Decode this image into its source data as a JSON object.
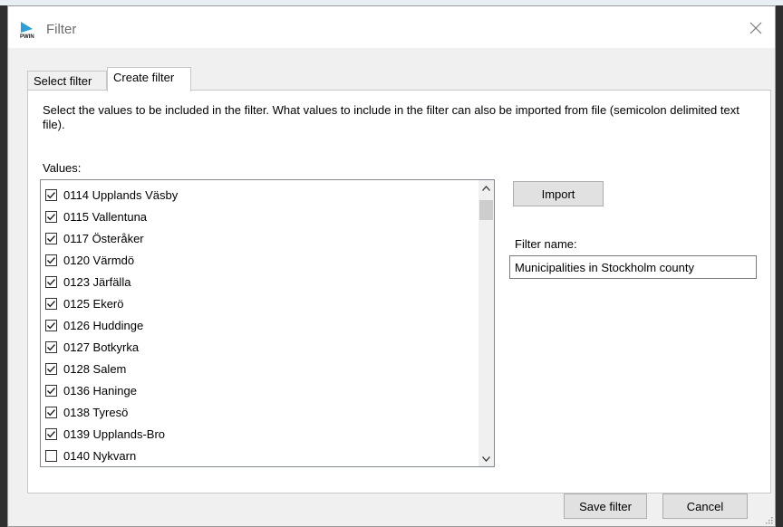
{
  "window": {
    "title": "Filter",
    "app_icon": "pwin-arrow-icon",
    "close_icon": "close-icon"
  },
  "tabs": [
    {
      "label": "Select filter",
      "active": false
    },
    {
      "label": "Create filter",
      "active": true
    }
  ],
  "description": "Select the values to be included in the filter. What values to include in the filter can also be imported from file (semicolon delimited text file).",
  "values_label": "Values:",
  "values": [
    {
      "label": "0114 Upplands Väsby",
      "checked": true
    },
    {
      "label": "0115 Vallentuna",
      "checked": true
    },
    {
      "label": "0117 Österåker",
      "checked": true
    },
    {
      "label": "0120 Värmdö",
      "checked": true
    },
    {
      "label": "0123 Järfälla",
      "checked": true
    },
    {
      "label": "0125 Ekerö",
      "checked": true
    },
    {
      "label": "0126 Huddinge",
      "checked": true
    },
    {
      "label": "0127 Botkyrka",
      "checked": true
    },
    {
      "label": "0128 Salem",
      "checked": true
    },
    {
      "label": "0136 Haninge",
      "checked": true
    },
    {
      "label": "0138 Tyresö",
      "checked": true
    },
    {
      "label": "0139 Upplands-Bro",
      "checked": true
    },
    {
      "label": "0140 Nykvarn",
      "checked": false
    }
  ],
  "import_label": "Import",
  "filter_name": {
    "label": "Filter name:",
    "value": "Municipalities in Stockholm county"
  },
  "buttons": {
    "save": "Save filter",
    "cancel": "Cancel"
  }
}
